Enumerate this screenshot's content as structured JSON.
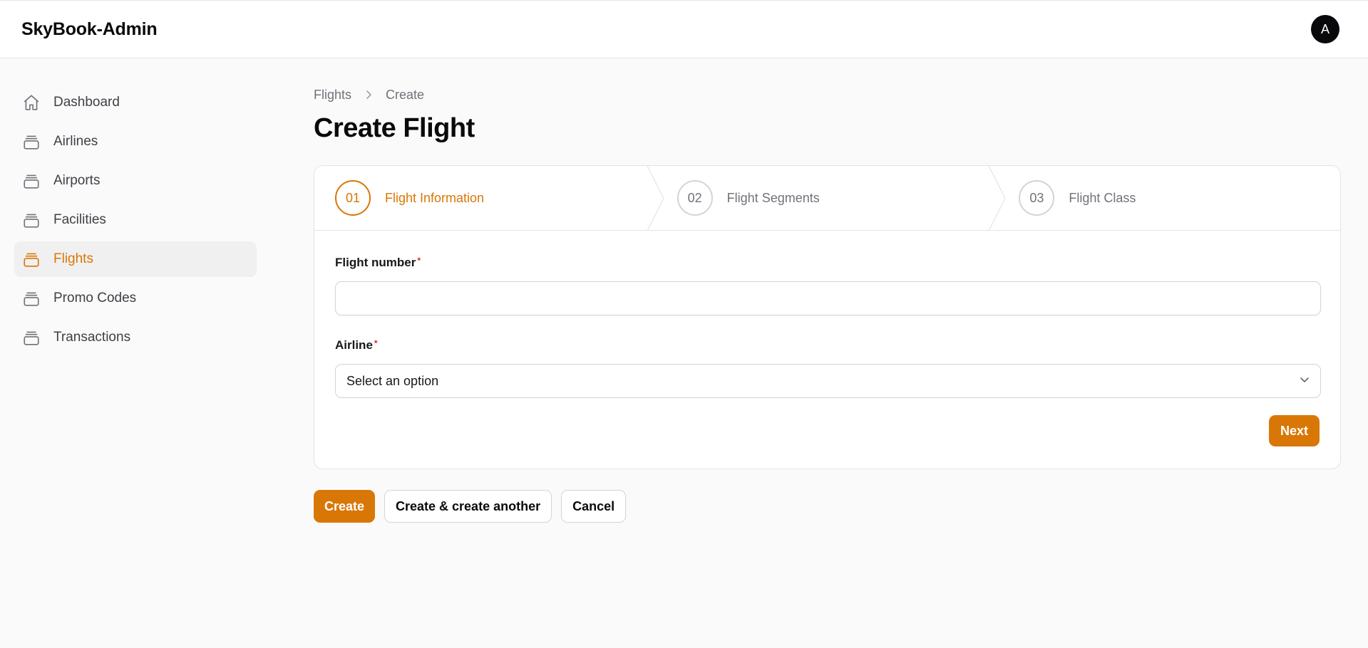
{
  "header": {
    "brand": "SkyBook-Admin",
    "avatar_initial": "A"
  },
  "sidebar": {
    "items": [
      {
        "label": "Dashboard",
        "icon": "home-icon"
      },
      {
        "label": "Airlines",
        "icon": "stack-icon"
      },
      {
        "label": "Airports",
        "icon": "stack-icon"
      },
      {
        "label": "Facilities",
        "icon": "stack-icon"
      },
      {
        "label": "Flights",
        "icon": "stack-icon",
        "active": true
      },
      {
        "label": "Promo Codes",
        "icon": "stack-icon"
      },
      {
        "label": "Transactions",
        "icon": "stack-icon"
      }
    ]
  },
  "breadcrumb": {
    "parent": "Flights",
    "current": "Create"
  },
  "page": {
    "title": "Create Flight"
  },
  "wizard": {
    "steps": [
      {
        "number": "01",
        "label": "Flight Information",
        "state": "current"
      },
      {
        "number": "02",
        "label": "Flight Segments",
        "state": "upcoming"
      },
      {
        "number": "03",
        "label": "Flight Class",
        "state": "upcoming"
      }
    ],
    "fields": {
      "flight_number": {
        "label": "Flight number",
        "required_mark": "*",
        "value": ""
      },
      "airline": {
        "label": "Airline",
        "required_mark": "*",
        "selected": "Select an option"
      }
    },
    "next_label": "Next"
  },
  "actions": {
    "create": "Create",
    "create_another": "Create & create another",
    "cancel": "Cancel"
  },
  "colors": {
    "accent": "#d97706",
    "required": "#dc2626"
  }
}
